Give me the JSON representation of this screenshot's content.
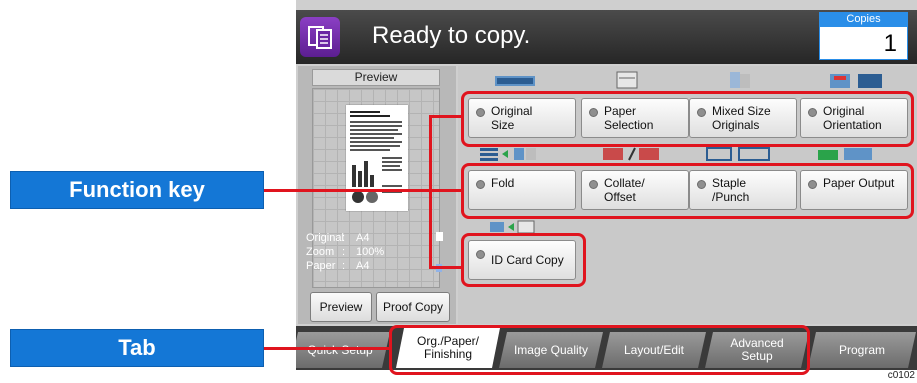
{
  "callouts": {
    "function_key": "Function key",
    "tab": "Tab"
  },
  "header": {
    "status": "Ready to copy.",
    "copies_label": "Copies",
    "copies_value": "1"
  },
  "preview": {
    "title": "Preview",
    "info": [
      {
        "label": "Original",
        "value": "A4"
      },
      {
        "label": "Zoom",
        "value": "100%"
      },
      {
        "label": "Paper",
        "value": "A4"
      }
    ],
    "preview_button": "Preview",
    "proof_copy_button": "Proof Copy"
  },
  "function_keys": {
    "row1": [
      "Original\nSize",
      "Paper\nSelection",
      "Mixed Size\nOriginals",
      "Original\nOrientation"
    ],
    "row2": [
      "Fold",
      "Collate/\nOffset",
      "Staple\n/Punch",
      "Paper Output"
    ],
    "row3": [
      "ID Card Copy"
    ]
  },
  "tabs": [
    {
      "label": "Quick Setup",
      "active": false
    },
    {
      "label": "Org./Paper/\nFinishing",
      "active": true
    },
    {
      "label": "Image Quality",
      "active": false
    },
    {
      "label": "Layout/Edit",
      "active": false
    },
    {
      "label": "Advanced\nSetup",
      "active": false
    },
    {
      "label": "Program",
      "active": false
    }
  ],
  "figure_code": "c0102",
  "colors": {
    "callout_blue": "#1477d6",
    "highlight_red": "#e0141e",
    "copies_blue": "#2a8ee8",
    "app_icon_purple": "#7a2fb6"
  },
  "icons": {
    "app": "copy-app-icon",
    "key_indicator": "radio-dot-icon"
  }
}
